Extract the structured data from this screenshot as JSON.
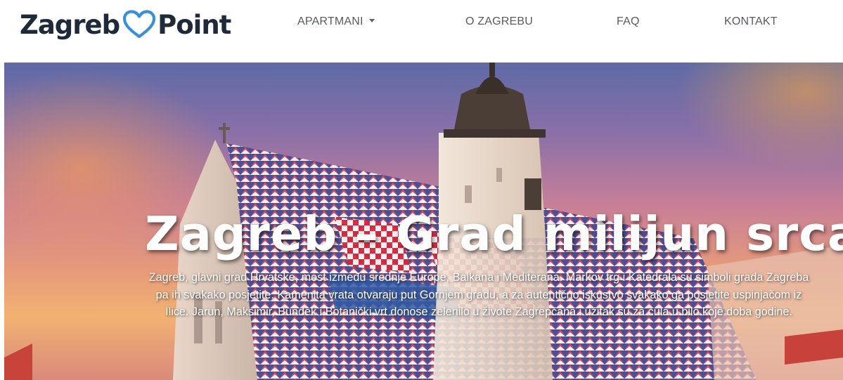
{
  "brand": {
    "name_left": "Zagreb",
    "name_right": "Point",
    "heart_color": "#3b8fd9",
    "text_color": "#1e2a3a"
  },
  "nav": {
    "items": [
      {
        "label": "APARTMANI",
        "has_dropdown": true
      },
      {
        "label": "O ZAGREBU",
        "has_dropdown": false
      },
      {
        "label": "FAQ",
        "has_dropdown": false
      },
      {
        "label": "KONTAKT",
        "has_dropdown": false
      }
    ]
  },
  "hero": {
    "title": "Zagreb – Grad milijun srca",
    "description": "Zagreb, glavni grad Hrvatske, most između srednje Europe, Balkana i Mediterana. Markov trg i Katedrala su simboli grada Zagreba pa ih svakako posjetite. Kamenita vrata otvaraju put Gornjem gradu, a za autentično iskustvo svakako ga posjetite uspinjačom iz Ilice. Jarun, Maksimir, Bundek i Botanički vrt donose zelenilo u živote Zagrepčana i užitak su za čula u bilo koje doba godine.",
    "image_subject": "st-marks-church"
  }
}
